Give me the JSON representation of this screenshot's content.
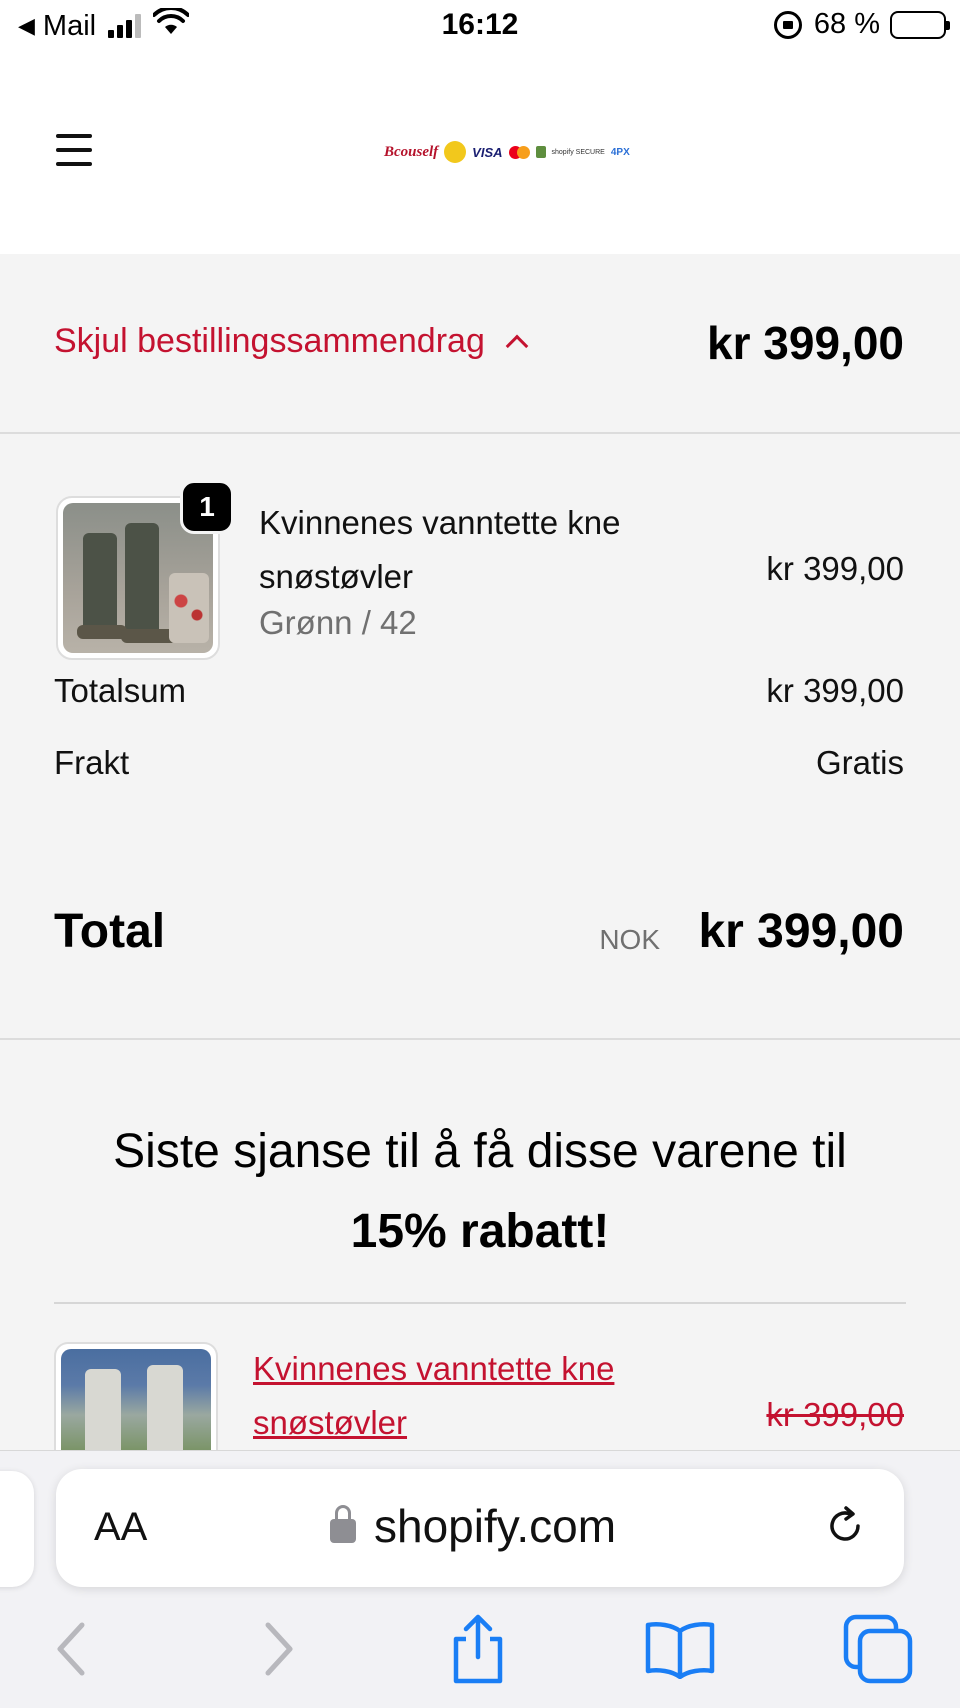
{
  "status_bar": {
    "back_app": "Mail",
    "time": "16:12",
    "battery": "68 %",
    "battery_level": 0.68
  },
  "header": {
    "logo_text": "Bcouself",
    "logo_visa": "VISA",
    "logo_shopify": "shopify",
    "logo_secure": "SECURE",
    "logo_4px": "4PX"
  },
  "summary_toggle": {
    "label": "Skjul bestillingssammendrag",
    "total": "kr 399,00"
  },
  "order": {
    "item": {
      "quantity": "1",
      "name": "Kvinnenes vanntette kne snøstøvler",
      "variant": "Grønn / 42",
      "price": "kr 399,00"
    },
    "subtotal_label": "Totalsum",
    "subtotal_value": "kr 399,00",
    "shipping_label": "Frakt",
    "shipping_value": "Gratis",
    "total_label": "Total",
    "total_currency": "NOK",
    "total_value": "kr 399,00"
  },
  "upsell": {
    "heading": "Siste sjanse til å få disse varene til",
    "heading_strong": "15% rabatt!",
    "item": {
      "name": "Kvinnenes vanntette kne snøstøvler",
      "old_price": "kr 399,00"
    }
  },
  "safari": {
    "text_size_label": "AA",
    "url": "shopify.com"
  },
  "colors": {
    "accent": "#c41230",
    "ios_blue": "#1a7ef5"
  }
}
